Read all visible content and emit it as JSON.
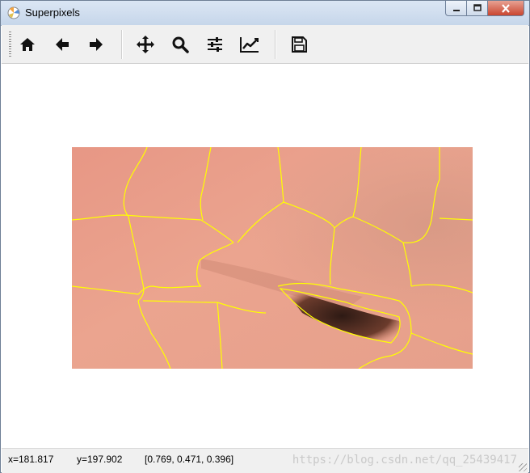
{
  "window": {
    "title": "Superpixels",
    "icon": "matplotlib-icon"
  },
  "toolbar": {
    "buttons": [
      {
        "name": "home-button",
        "icon": "home-icon"
      },
      {
        "name": "back-button",
        "icon": "arrow-left-icon"
      },
      {
        "name": "forward-button",
        "icon": "arrow-right-icon"
      },
      {
        "name": "pan-button",
        "icon": "move-icon"
      },
      {
        "name": "zoom-button",
        "icon": "search-icon"
      },
      {
        "name": "configure-subplots-button",
        "icon": "sliders-icon"
      },
      {
        "name": "edit-axes-button",
        "icon": "line-chart-icon"
      },
      {
        "name": "save-button",
        "icon": "floppy-disk-icon"
      }
    ]
  },
  "status": {
    "x": "x=181.817",
    "y": "y=197.902",
    "pixel": "[0.769, 0.471, 0.396]",
    "watermark": "https://blog.csdn.net/qq_25439417"
  },
  "figure": {
    "image": "superpixel-segmented-eye-photo",
    "boundary_color": "#ffff00",
    "skin_color": "#e59a82"
  }
}
